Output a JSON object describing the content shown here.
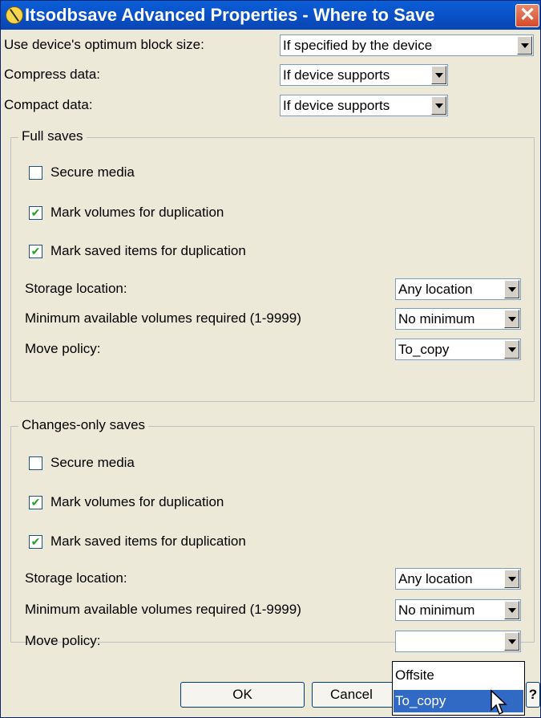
{
  "window": {
    "title": "Itsodbsave Advanced Properties - Where to Save",
    "close": "✕"
  },
  "top": {
    "block_size": {
      "label": "Use device's optimum block size:",
      "value": "If specified by the device"
    },
    "compress": {
      "label": "Compress data:",
      "value": "If device supports"
    },
    "compact": {
      "label": "Compact data:",
      "value": "If device supports"
    }
  },
  "full": {
    "title": "Full saves",
    "secure": {
      "label": "Secure media",
      "checked": false
    },
    "mark_volumes": {
      "label": "Mark volumes for duplication",
      "checked": true
    },
    "mark_items": {
      "label": "Mark saved items for duplication",
      "checked": true
    },
    "storage": {
      "label": "Storage location:",
      "value": "Any location"
    },
    "minvol": {
      "label": "Minimum available volumes required (1-9999)",
      "value": "No minimum"
    },
    "move": {
      "label": "Move policy:",
      "value": "To_copy"
    }
  },
  "changes": {
    "title": "Changes-only saves",
    "secure": {
      "label": "Secure media",
      "checked": false
    },
    "mark_volumes": {
      "label": "Mark volumes for duplication",
      "checked": true
    },
    "mark_items": {
      "label": "Mark saved items for duplication",
      "checked": true
    },
    "storage": {
      "label": "Storage location:",
      "value": "Any location"
    },
    "minvol": {
      "label": "Minimum available volumes required (1-9999)",
      "value": "No minimum"
    },
    "move": {
      "label": "Move policy:",
      "value": ""
    }
  },
  "dropdown_options": [
    "Offsite",
    "To_copy"
  ],
  "selected_option": "To_copy",
  "buttons": {
    "ok": "OK",
    "cancel": "Cancel",
    "help": "?"
  },
  "check_glyph": "✔"
}
